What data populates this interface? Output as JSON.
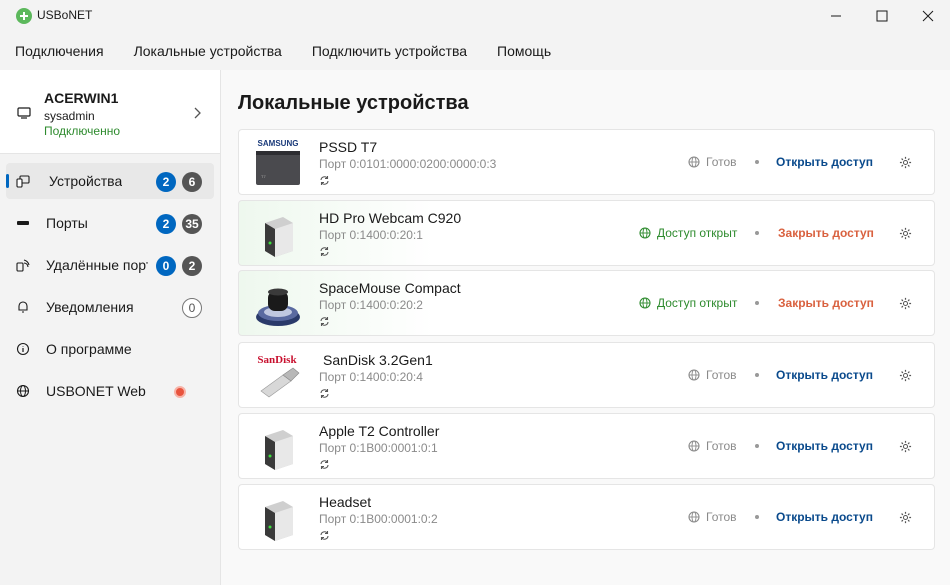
{
  "app": {
    "title": "USBoNET"
  },
  "menu": [
    "Подключения",
    "Локальные устройства",
    "Подключить устройства",
    "Помощь"
  ],
  "host": {
    "name": "ACERWIN1",
    "user": "sysadmin",
    "status": "Подключенно"
  },
  "nav": [
    {
      "label": "Устройства",
      "badges": [
        "2",
        "6"
      ],
      "active": true,
      "icon": "devices-icon"
    },
    {
      "label": "Порты",
      "badges": [
        "2",
        "35"
      ],
      "icon": "port-icon"
    },
    {
      "label": "Удалённые порты",
      "badges": [
        "0",
        "2"
      ],
      "icon": "remote-ports-icon"
    },
    {
      "label": "Уведомления",
      "badges": [
        "0"
      ],
      "icon": "bell-icon"
    },
    {
      "label": "О программе",
      "badges": [],
      "icon": "info-icon"
    },
    {
      "label": "USBONET Web",
      "badges": [],
      "icon": "globe-icon"
    }
  ],
  "main": {
    "title": "Локальные устройства"
  },
  "devices": [
    {
      "brand": "SAMSUNG",
      "name": "PSSD T7",
      "port": "Порт 0:0101:0000:0200:0000:0:3",
      "status": "Готов",
      "action": "Открыть доступ",
      "shared": false
    },
    {
      "brand": "",
      "name": "HD Pro Webcam C920",
      "port": "Порт 0:1400:0:20:1",
      "status": "Доступ открыт",
      "action": "Закрыть доступ",
      "shared": true
    },
    {
      "brand": "",
      "name": "SpaceMouse Compact",
      "port": "Порт 0:1400:0:20:2",
      "status": "Доступ открыт",
      "action": "Закрыть доступ",
      "shared": true
    },
    {
      "brand": "SanDisk",
      "name": "SanDisk 3.2Gen1",
      "port": "Порт 0:1400:0:20:4",
      "status": "Готов",
      "action": "Открыть доступ",
      "shared": false
    },
    {
      "brand": "",
      "name": "Apple T2 Controller",
      "port": "Порт 0:1B00:0001:0:1",
      "status": "Готов",
      "action": "Открыть доступ",
      "shared": false
    },
    {
      "brand": "",
      "name": "Headset",
      "port": "Порт 0:1B00:0001:0:2",
      "status": "Готов",
      "action": "Открыть доступ",
      "shared": false
    }
  ],
  "colors": {
    "accent": "#0067c0",
    "shared": "#2e8b2e",
    "close": "#d9613f",
    "badge_gray": "#555555"
  }
}
